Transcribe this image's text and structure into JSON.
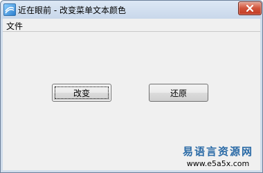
{
  "window": {
    "title": "近在眼前 - 改变菜单文本颜色",
    "close_icon": "close-icon",
    "app_icon": "app-icon"
  },
  "menu": {
    "items": [
      {
        "label": "文件"
      }
    ]
  },
  "buttons": {
    "change_label": "改变",
    "restore_label": "还原"
  },
  "watermark": {
    "text": "易语言资源网",
    "url": "www.e5a5x.com"
  },
  "colors": {
    "title_bar": "#dde8f5",
    "close_button": "#d0533a",
    "client_bg": "#f0f0f0",
    "watermark_text": "#2a6aa6"
  }
}
